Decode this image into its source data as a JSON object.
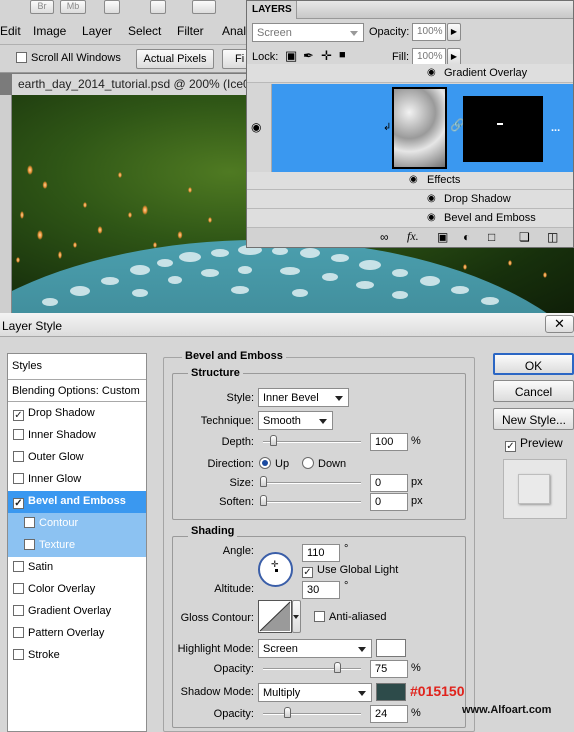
{
  "menubar": {
    "items": [
      "Edit",
      "Image",
      "Layer",
      "Select",
      "Filter",
      "Anal"
    ],
    "app_buttons": [
      "Br",
      "Mb"
    ]
  },
  "options_bar": {
    "scroll_all_label": "Scroll All Windows",
    "actual_pixels_label": "Actual Pixels",
    "fit_label": "Fi"
  },
  "document": {
    "tab_title": "earth_day_2014_tutorial.psd @ 200% (Ice00"
  },
  "layers_panel": {
    "title": "LAYERS",
    "blend_mode": "Screen",
    "opacity_label": "Opacity:",
    "opacity_value": "100%",
    "lock_label": "Lock:",
    "fill_label": "Fill:",
    "fill_value": "100%",
    "rows": [
      {
        "label": "Gradient Overlay"
      },
      {
        "label": "Effects"
      },
      {
        "label": "Drop Shadow"
      },
      {
        "label": "Bevel and Emboss"
      }
    ],
    "more": "...",
    "selected_color": "#3a98f0"
  },
  "dialog": {
    "title": "Layer Style",
    "styles_header": "Styles",
    "blending_options": "Blending Options: Custom",
    "styles": [
      {
        "label": "Drop Shadow",
        "checked": true
      },
      {
        "label": "Inner Shadow",
        "checked": false
      },
      {
        "label": "Outer Glow",
        "checked": false
      },
      {
        "label": "Inner Glow",
        "checked": false
      },
      {
        "label": "Bevel and Emboss",
        "checked": true
      },
      {
        "label": "Contour",
        "checked": false
      },
      {
        "label": "Texture",
        "checked": false
      },
      {
        "label": "Satin",
        "checked": false
      },
      {
        "label": "Color Overlay",
        "checked": false
      },
      {
        "label": "Gradient Overlay",
        "checked": false
      },
      {
        "label": "Pattern Overlay",
        "checked": false
      },
      {
        "label": "Stroke",
        "checked": false
      }
    ],
    "section_title": "Bevel and Emboss",
    "structure": {
      "title": "Structure",
      "style_label": "Style:",
      "style_value": "Inner Bevel",
      "technique_label": "Technique:",
      "technique_value": "Smooth",
      "depth_label": "Depth:",
      "depth_value": "100",
      "depth_level": 0.1,
      "direction_label": "Direction:",
      "up_label": "Up",
      "down_label": "Down",
      "size_label": "Size:",
      "size_value": "0",
      "size_level": 0,
      "soften_label": "Soften:",
      "soften_value": "0",
      "soften_level": 0,
      "percent": "%",
      "px": "px"
    },
    "shading": {
      "title": "Shading",
      "angle_label": "Angle:",
      "angle_value": "110",
      "degree": "°",
      "global_light_label": "Use Global Light",
      "altitude_label": "Altitude:",
      "altitude_value": "30",
      "gloss_label": "Gloss Contour:",
      "antialiased_label": "Anti-aliased",
      "highlight_label": "Highlight Mode:",
      "highlight_value": "Screen",
      "highlight_color": "#ffffff",
      "hl_opacity_label": "Opacity:",
      "hl_opacity_value": "75",
      "hl_opacity_level": 0.75,
      "shadow_label": "Shadow Mode:",
      "shadow_value": "Multiply",
      "shadow_color": "#2d4b4a",
      "shadow_hex_annotation": "#015150",
      "sh_opacity_label": "Opacity:",
      "sh_opacity_value": "24",
      "sh_opacity_level": 0.24
    },
    "buttons": {
      "ok": "OK",
      "cancel": "Cancel",
      "new_style": "New Style...",
      "preview": "Preview"
    },
    "watermark": "www.Alfoart.com"
  }
}
